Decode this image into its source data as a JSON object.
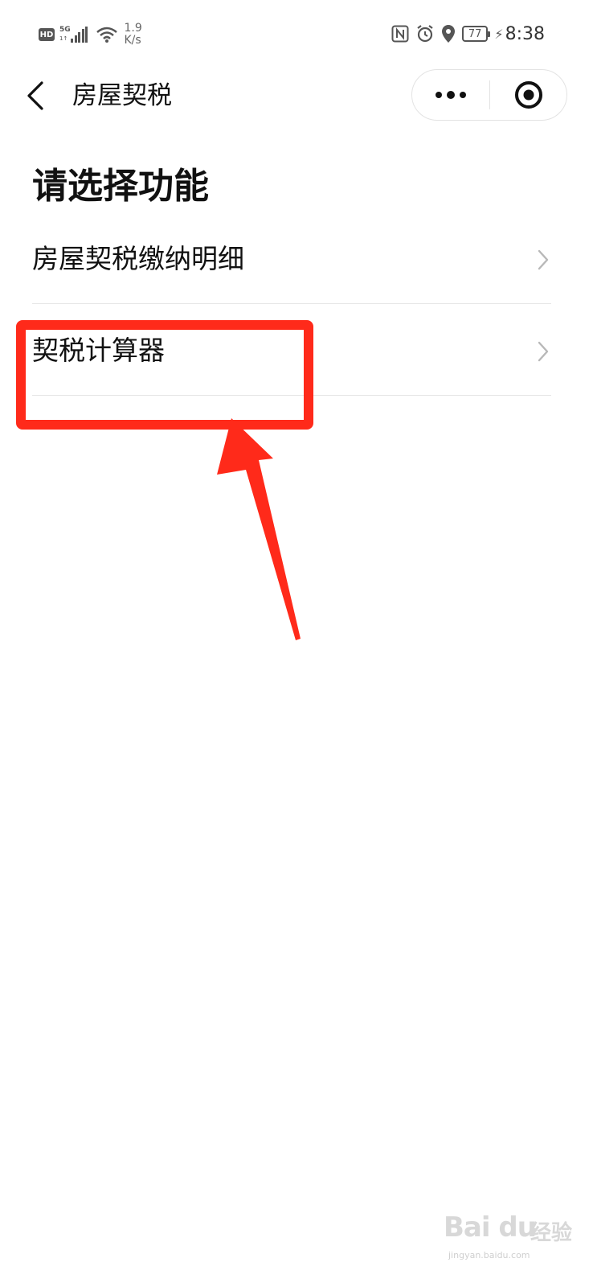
{
  "status_bar": {
    "hd": "HD",
    "network": "5G",
    "net_sub": "1↑",
    "speed_value": "1.9",
    "speed_unit": "K/s",
    "battery": "77",
    "time": "8:38"
  },
  "header": {
    "title": "房屋契税"
  },
  "main": {
    "heading": "请选择功能",
    "items": [
      {
        "label": "房屋契税缴纳明细"
      },
      {
        "label": "契税计算器"
      }
    ]
  },
  "annotation": {
    "color": "#ff2a1a"
  },
  "watermark": {
    "brand": "Bai du",
    "brand_cn": "经验",
    "url": "jingyan.baidu.com"
  }
}
